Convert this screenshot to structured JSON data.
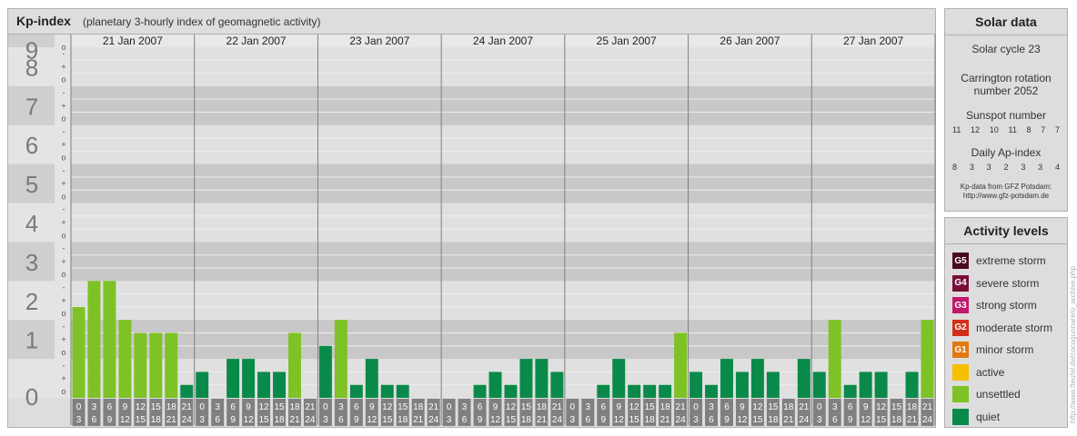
{
  "header": {
    "title": "Kp-index",
    "subtitle": "(planetary 3-hourly index of geomagnetic activity)"
  },
  "chart_data": {
    "type": "bar",
    "ylim": [
      0,
      9
    ],
    "y_major_ticks": [
      "0",
      "1",
      "2",
      "3",
      "4",
      "5",
      "6",
      "7",
      "8",
      "9"
    ],
    "y_minor_marks": [
      "-",
      "o",
      "+"
    ],
    "days": [
      "21 Jan 2007",
      "22 Jan 2007",
      "23 Jan 2007",
      "24 Jan 2007",
      "25 Jan 2007",
      "26 Jan 2007",
      "27 Jan 2007"
    ],
    "interval_labels": [
      [
        "0",
        "3"
      ],
      [
        "3",
        "6"
      ],
      [
        "6",
        "9"
      ],
      [
        "9",
        "12"
      ],
      [
        "12",
        "15"
      ],
      [
        "15",
        "18"
      ],
      [
        "18",
        "21"
      ],
      [
        "21",
        "24"
      ]
    ],
    "values": [
      [
        2.333,
        3.0,
        3.0,
        2.0,
        1.667,
        1.667,
        1.667,
        0.333
      ],
      [
        0.667,
        0.0,
        1.0,
        1.0,
        0.667,
        0.667,
        1.667,
        0.0
      ],
      [
        1.333,
        2.0,
        0.333,
        1.0,
        0.333,
        0.333,
        0.0,
        0.0
      ],
      [
        0.0,
        0.0,
        0.333,
        0.667,
        0.333,
        1.0,
        1.0,
        0.667
      ],
      [
        0.0,
        0.0,
        0.333,
        1.0,
        0.333,
        0.333,
        0.333,
        1.667
      ],
      [
        0.667,
        0.333,
        1.0,
        0.667,
        1.0,
        0.667,
        0.0,
        1.0
      ],
      [
        0.667,
        2.0,
        0.333,
        0.667,
        0.667,
        0.0,
        0.667,
        2.0
      ]
    ],
    "colors": {
      "quiet": "#0a8a4a",
      "unsettled": "#7ec225",
      "band_dark": "#c8c8c8",
      "band_light": "#e0e0e0",
      "grid": "#eeeeee",
      "day_line": "#808080",
      "label_box": "#808080"
    },
    "quiet_threshold": 1.5
  },
  "solar": {
    "title": "Solar data",
    "cycle": "Solar cycle 23",
    "carrington": "Carrington rotation number 2052",
    "sunspot_label": "Sunspot number",
    "sunspot_values": [
      "11",
      "12",
      "10",
      "11",
      "8",
      "7",
      "7"
    ],
    "ap_label": "Daily Ap-index",
    "ap_values": [
      "8",
      "3",
      "3",
      "2",
      "3",
      "3",
      "4"
    ],
    "credit_line1": "Kp-data from GFZ Potsdam:",
    "credit_line2": "http://www.gfz-potsdam.de"
  },
  "activity": {
    "title": "Activity levels",
    "items": [
      {
        "code": "G5",
        "label": "extreme storm",
        "color": "#4a0a20"
      },
      {
        "code": "G4",
        "label": "severe storm",
        "color": "#7a0e3a"
      },
      {
        "code": "G3",
        "label": "strong storm",
        "color": "#c0186a"
      },
      {
        "code": "G2",
        "label": "moderate storm",
        "color": "#d0301a"
      },
      {
        "code": "G1",
        "label": "minor storm",
        "color": "#e07a10"
      },
      {
        "code": "",
        "label": "active",
        "color": "#f5c000"
      },
      {
        "code": "",
        "label": "unsettled",
        "color": "#7ec225"
      },
      {
        "code": "",
        "label": "quiet",
        "color": "#0a8a4a"
      }
    ]
  },
  "watermark": "http://www.fteufel.de/cocogunnare/o_archive.php"
}
